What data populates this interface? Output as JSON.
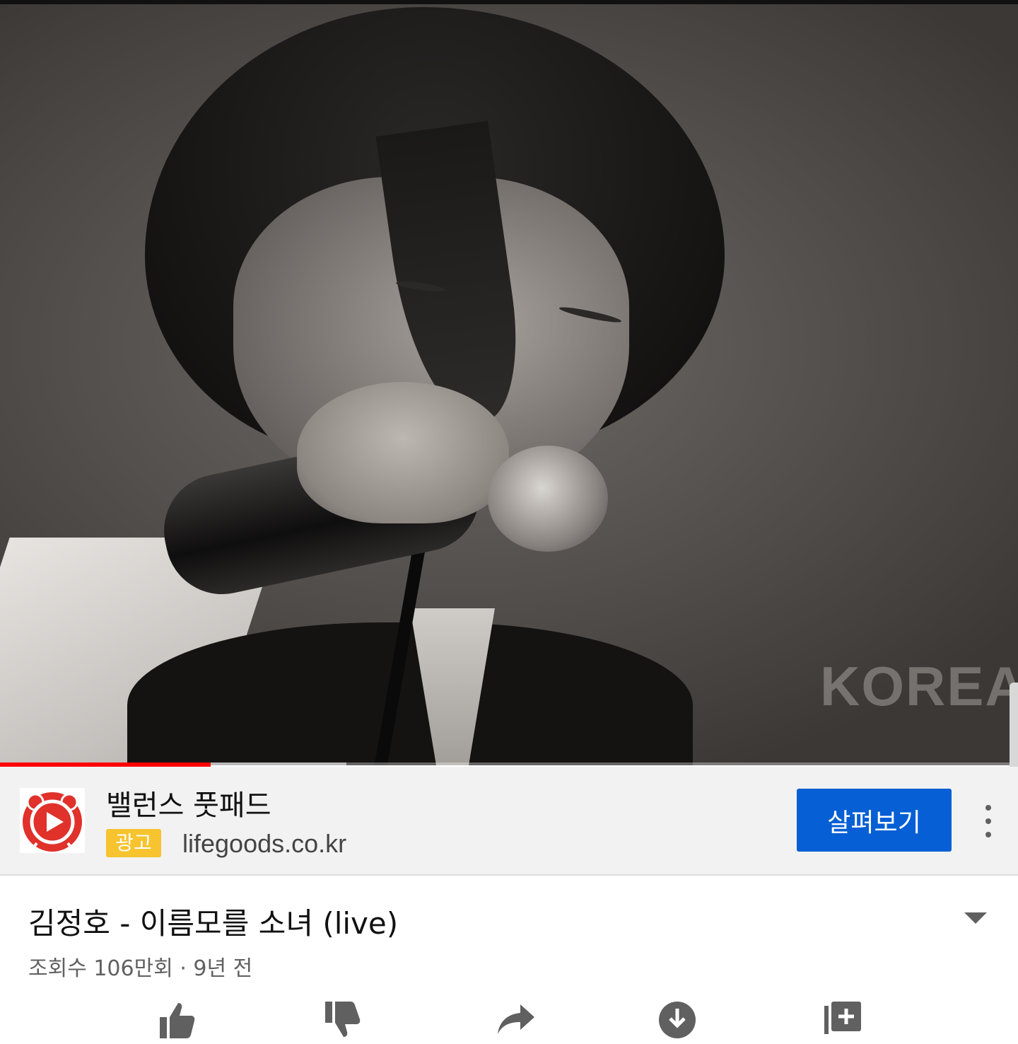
{
  "video": {
    "watermark": "KOREA",
    "progress_played": 0.207,
    "progress_buffered": 0.34
  },
  "ad": {
    "title": "밸런스 풋패드",
    "badge": "광고",
    "url": "lifegoods.co.kr",
    "cta_label": "살펴보기",
    "colors": {
      "badge": "#f7c32e",
      "cta": "#065fd4",
      "logo": "#e0312b"
    }
  },
  "info": {
    "title": "김정호 - 이름모를 소녀 (live)",
    "meta": "조회수 106만회 · 9년 전"
  },
  "actions": [
    "like-icon",
    "dislike-icon",
    "share-icon",
    "download-icon",
    "save-to-playlist-icon"
  ]
}
